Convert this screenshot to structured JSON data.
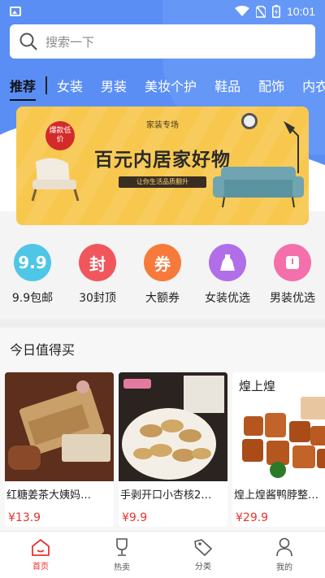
{
  "status_bar": {
    "time": "10:01"
  },
  "search": {
    "placeholder": "搜索一下"
  },
  "categories": [
    "推荐",
    "女装",
    "男装",
    "美妆个护",
    "鞋品",
    "配饰",
    "内衣"
  ],
  "banner": {
    "badge": "爆款低价",
    "pre_title": "家装专场",
    "title": "百元内居家好物",
    "subtitle": "让你生活品质翻升"
  },
  "quick_entries": [
    {
      "label": "9.9包邮",
      "glyph": "9.9",
      "color": "#4fc6e6"
    },
    {
      "label": "30封顶",
      "glyph": "封",
      "color": "#f0565c"
    },
    {
      "label": "大额券",
      "glyph": "券",
      "color": "#f77a3a"
    },
    {
      "label": "女装优选",
      "glyph": "dress-icon",
      "color": "#b06ee9"
    },
    {
      "label": "男装优选",
      "glyph": "shirt-icon",
      "color": "#f56faa"
    }
  ],
  "today_section": {
    "title": "今日值得买"
  },
  "products": [
    {
      "name": "红糖姜茶大姨妈…",
      "price": "¥13.9",
      "image": "brown-sugar-ginger-tea"
    },
    {
      "name": "手剥开口小杏核2…",
      "price": "¥9.9",
      "image": "apricot-kernels"
    },
    {
      "name": "煌上煌酱鸭脖整…",
      "price": "¥29.9",
      "image": "braised-duck-neck",
      "brand_text": "煌上煌"
    }
  ],
  "tabbar": [
    {
      "label": "首页",
      "icon": "home-icon",
      "active": true
    },
    {
      "label": "热卖",
      "icon": "trophy-icon",
      "active": false
    },
    {
      "label": "分类",
      "icon": "tag-icon",
      "active": false
    },
    {
      "label": "我的",
      "icon": "user-icon",
      "active": false
    }
  ],
  "colors": {
    "primary": "#5a8ef5",
    "price": "#e8322e",
    "active_tab": "#e8322e"
  }
}
